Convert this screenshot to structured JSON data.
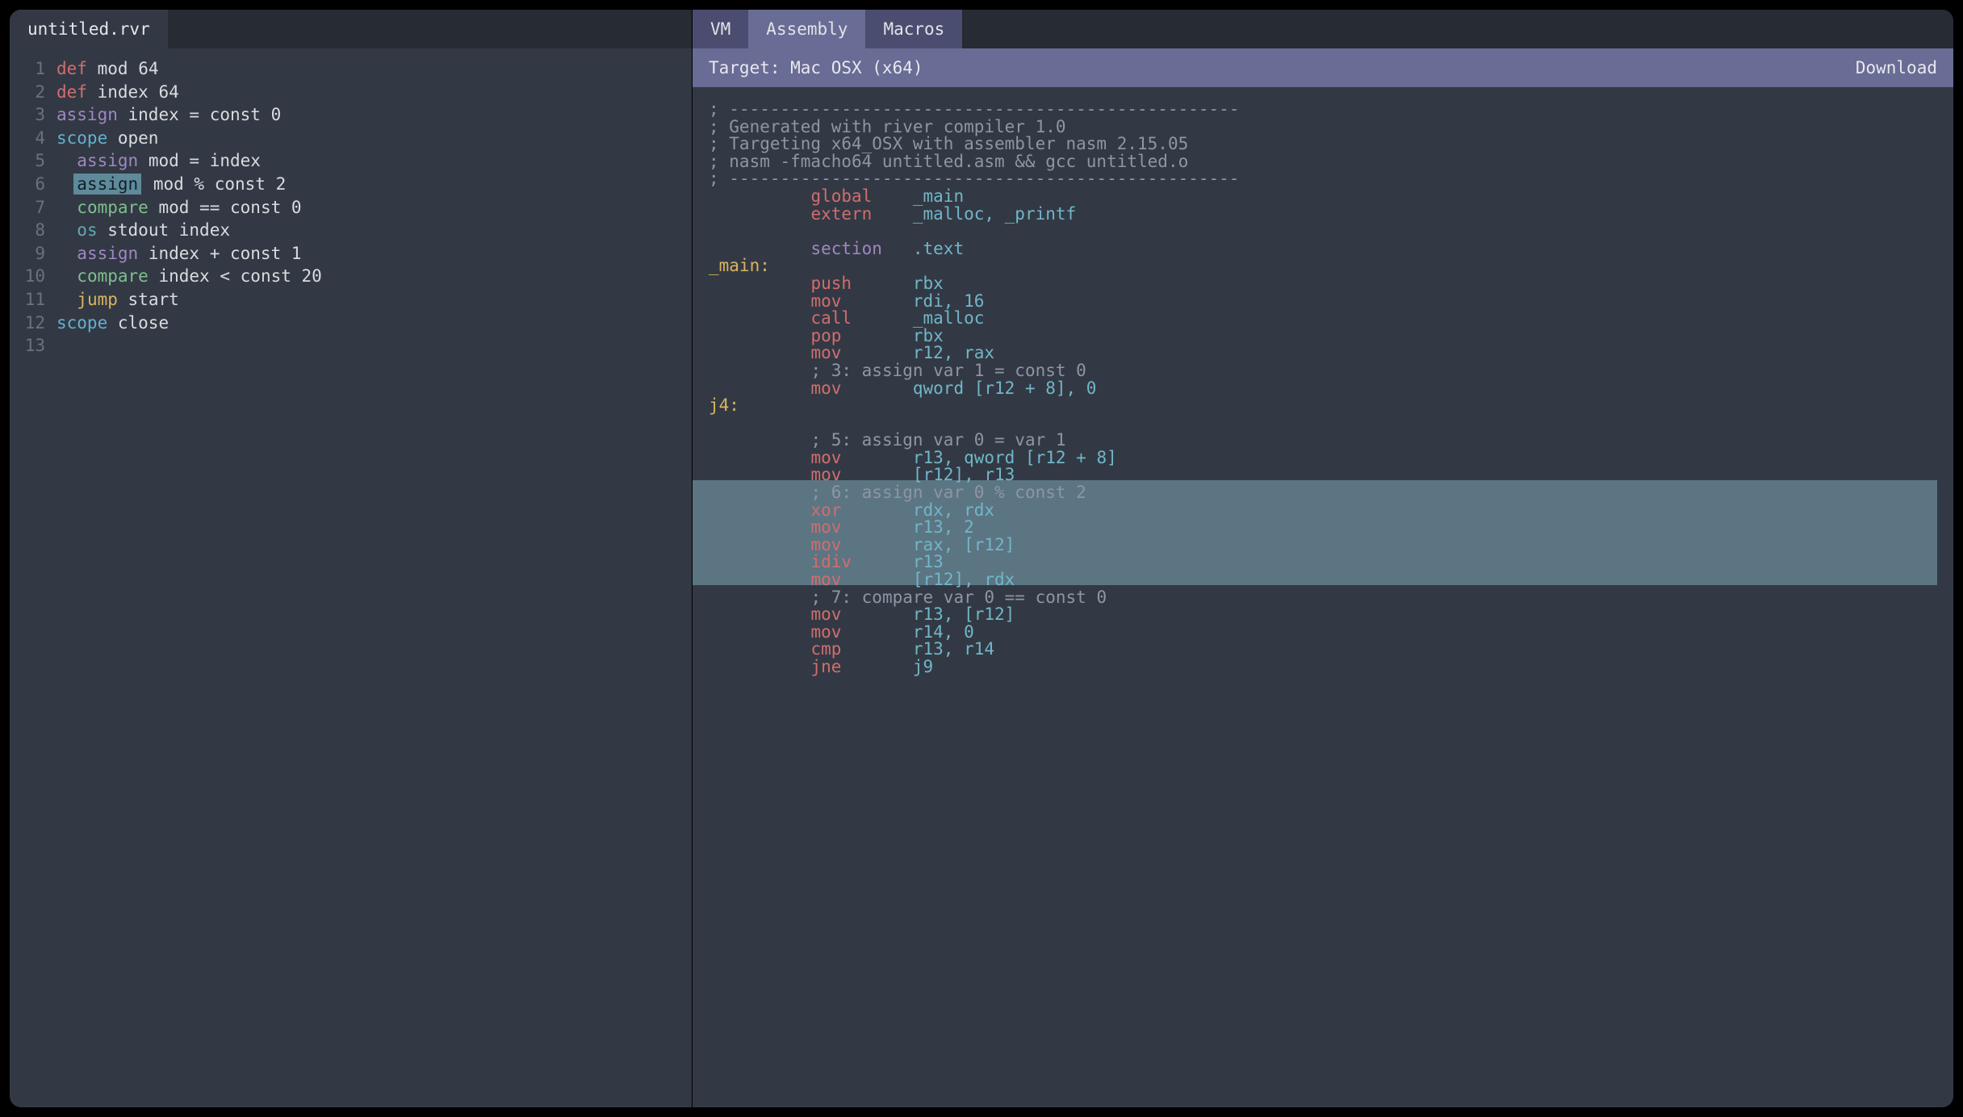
{
  "left": {
    "filename": "untitled.rvr",
    "lines": [
      {
        "n": 1,
        "indent": 0,
        "tokens": [
          [
            "kw-def",
            "def"
          ],
          [
            "sp",
            " "
          ],
          [
            "ident",
            "mod"
          ],
          [
            "sp",
            " "
          ],
          [
            "num",
            "64"
          ]
        ]
      },
      {
        "n": 2,
        "indent": 0,
        "tokens": [
          [
            "kw-def",
            "def"
          ],
          [
            "sp",
            " "
          ],
          [
            "ident",
            "index"
          ],
          [
            "sp",
            " "
          ],
          [
            "num",
            "64"
          ]
        ]
      },
      {
        "n": 3,
        "indent": 0,
        "tokens": [
          [
            "kw-assign",
            "assign"
          ],
          [
            "sp",
            " "
          ],
          [
            "ident",
            "index"
          ],
          [
            "sp",
            " "
          ],
          [
            "op",
            "="
          ],
          [
            "sp",
            " "
          ],
          [
            "const",
            "const"
          ],
          [
            "sp",
            " "
          ],
          [
            "num",
            "0"
          ]
        ]
      },
      {
        "n": 4,
        "indent": 0,
        "tokens": [
          [
            "kw-scope",
            "scope"
          ],
          [
            "sp",
            " "
          ],
          [
            "ident",
            "open"
          ]
        ]
      },
      {
        "n": 5,
        "indent": 1,
        "tokens": [
          [
            "kw-assign",
            "assign"
          ],
          [
            "sp",
            " "
          ],
          [
            "ident",
            "mod"
          ],
          [
            "sp",
            " "
          ],
          [
            "op",
            "="
          ],
          [
            "sp",
            " "
          ],
          [
            "ident",
            "index"
          ]
        ]
      },
      {
        "n": 6,
        "indent": 1,
        "highlightFirst": true,
        "tokens": [
          [
            "kw-assign",
            "assign"
          ],
          [
            "sp",
            " "
          ],
          [
            "ident",
            "mod"
          ],
          [
            "sp",
            " "
          ],
          [
            "op",
            "%"
          ],
          [
            "sp",
            " "
          ],
          [
            "const",
            "const"
          ],
          [
            "sp",
            " "
          ],
          [
            "num",
            "2"
          ]
        ]
      },
      {
        "n": 7,
        "indent": 1,
        "tokens": [
          [
            "kw-compare",
            "compare"
          ],
          [
            "sp",
            " "
          ],
          [
            "ident",
            "mod"
          ],
          [
            "sp",
            " "
          ],
          [
            "op",
            "=="
          ],
          [
            "sp",
            " "
          ],
          [
            "const",
            "const"
          ],
          [
            "sp",
            " "
          ],
          [
            "num",
            "0"
          ]
        ]
      },
      {
        "n": 8,
        "indent": 1,
        "tokens": [
          [
            "kw-os",
            "os"
          ],
          [
            "sp",
            " "
          ],
          [
            "ident",
            "stdout"
          ],
          [
            "sp",
            " "
          ],
          [
            "ident",
            "index"
          ]
        ]
      },
      {
        "n": 9,
        "indent": 1,
        "tokens": [
          [
            "kw-assign",
            "assign"
          ],
          [
            "sp",
            " "
          ],
          [
            "ident",
            "index"
          ],
          [
            "sp",
            " "
          ],
          [
            "op",
            "+"
          ],
          [
            "sp",
            " "
          ],
          [
            "const",
            "const"
          ],
          [
            "sp",
            " "
          ],
          [
            "num",
            "1"
          ]
        ]
      },
      {
        "n": 10,
        "indent": 1,
        "tokens": [
          [
            "kw-compare",
            "compare"
          ],
          [
            "sp",
            " "
          ],
          [
            "ident",
            "index"
          ],
          [
            "sp",
            " "
          ],
          [
            "op",
            "<"
          ],
          [
            "sp",
            " "
          ],
          [
            "const",
            "const"
          ],
          [
            "sp",
            " "
          ],
          [
            "num",
            "20"
          ]
        ]
      },
      {
        "n": 11,
        "indent": 1,
        "tokens": [
          [
            "kw-jump",
            "jump"
          ],
          [
            "sp",
            " "
          ],
          [
            "ident",
            "start"
          ]
        ]
      },
      {
        "n": 12,
        "indent": 0,
        "tokens": [
          [
            "kw-scope",
            "scope"
          ],
          [
            "sp",
            " "
          ],
          [
            "ident",
            "close"
          ]
        ]
      },
      {
        "n": 13,
        "indent": 0,
        "tokens": []
      }
    ]
  },
  "right": {
    "tabs": [
      {
        "label": "VM",
        "active": false
      },
      {
        "label": "Assembly",
        "active": true
      },
      {
        "label": "Macros",
        "active": false
      }
    ],
    "target_label": "Target: Mac OSX (x64)",
    "download_label": "Download",
    "asm": [
      {
        "t": "comment",
        "text": "; --------------------------------------------------"
      },
      {
        "t": "comment",
        "text": "; Generated with river compiler 1.0"
      },
      {
        "t": "comment",
        "text": "; Targeting x64_OSX with assembler nasm 2.15.05"
      },
      {
        "t": "comment",
        "text": "; nasm -fmacho64 untitled.asm && gcc untitled.o"
      },
      {
        "t": "comment",
        "text": "; --------------------------------------------------"
      },
      {
        "t": "instr",
        "pad": 10,
        "instr": "global",
        "args": "_main"
      },
      {
        "t": "instr",
        "pad": 10,
        "instr": "extern",
        "args": "_malloc, _printf"
      },
      {
        "t": "blank"
      },
      {
        "t": "directive",
        "pad": 10,
        "instr": "section",
        "args": ".text"
      },
      {
        "t": "label",
        "text": "_main:"
      },
      {
        "t": "instr",
        "pad": 10,
        "instr": "push",
        "args": "rbx"
      },
      {
        "t": "instr",
        "pad": 10,
        "instr": "mov",
        "args": "rdi, 16"
      },
      {
        "t": "instr",
        "pad": 10,
        "instr": "call",
        "args": "_malloc"
      },
      {
        "t": "instr",
        "pad": 10,
        "instr": "pop",
        "args": "rbx"
      },
      {
        "t": "instr",
        "pad": 10,
        "instr": "mov",
        "args": "r12, rax"
      },
      {
        "t": "comment-indented",
        "pad": 10,
        "text": "; 3: assign var 1 = const 0"
      },
      {
        "t": "instr",
        "pad": 10,
        "instr": "mov",
        "args": "qword [r12 + 8], 0"
      },
      {
        "t": "label",
        "text": "j4:"
      },
      {
        "t": "blank"
      },
      {
        "t": "comment-indented",
        "pad": 10,
        "text": "; 5: assign var 0 = var 1"
      },
      {
        "t": "instr",
        "pad": 10,
        "instr": "mov",
        "args": "r13, qword [r12 + 8]"
      },
      {
        "t": "instr",
        "pad": 10,
        "instr": "mov",
        "args": "[r12], r13"
      },
      {
        "t": "comment-indented",
        "pad": 10,
        "text": "; 6: assign var 0 % const 2",
        "hl": true
      },
      {
        "t": "instr",
        "pad": 10,
        "instr": "xor",
        "args": "rdx, rdx",
        "hl": true
      },
      {
        "t": "instr",
        "pad": 10,
        "instr": "mov",
        "args": "r13, 2",
        "hl": true
      },
      {
        "t": "instr",
        "pad": 10,
        "instr": "mov",
        "args": "rax, [r12]",
        "hl": true
      },
      {
        "t": "instr",
        "pad": 10,
        "instr": "idiv",
        "args": "r13",
        "hl": true
      },
      {
        "t": "instr",
        "pad": 10,
        "instr": "mov",
        "args": "[r12], rdx",
        "hl": true
      },
      {
        "t": "comment-indented",
        "pad": 10,
        "text": "; 7: compare var 0 == const 0"
      },
      {
        "t": "instr",
        "pad": 10,
        "instr": "mov",
        "args": "r13, [r12]"
      },
      {
        "t": "instr",
        "pad": 10,
        "instr": "mov",
        "args": "r14, 0"
      },
      {
        "t": "instr",
        "pad": 10,
        "instr": "cmp",
        "args": "r13, r14"
      },
      {
        "t": "instr",
        "pad": 10,
        "instr": "jne",
        "args": "j9"
      }
    ]
  }
}
